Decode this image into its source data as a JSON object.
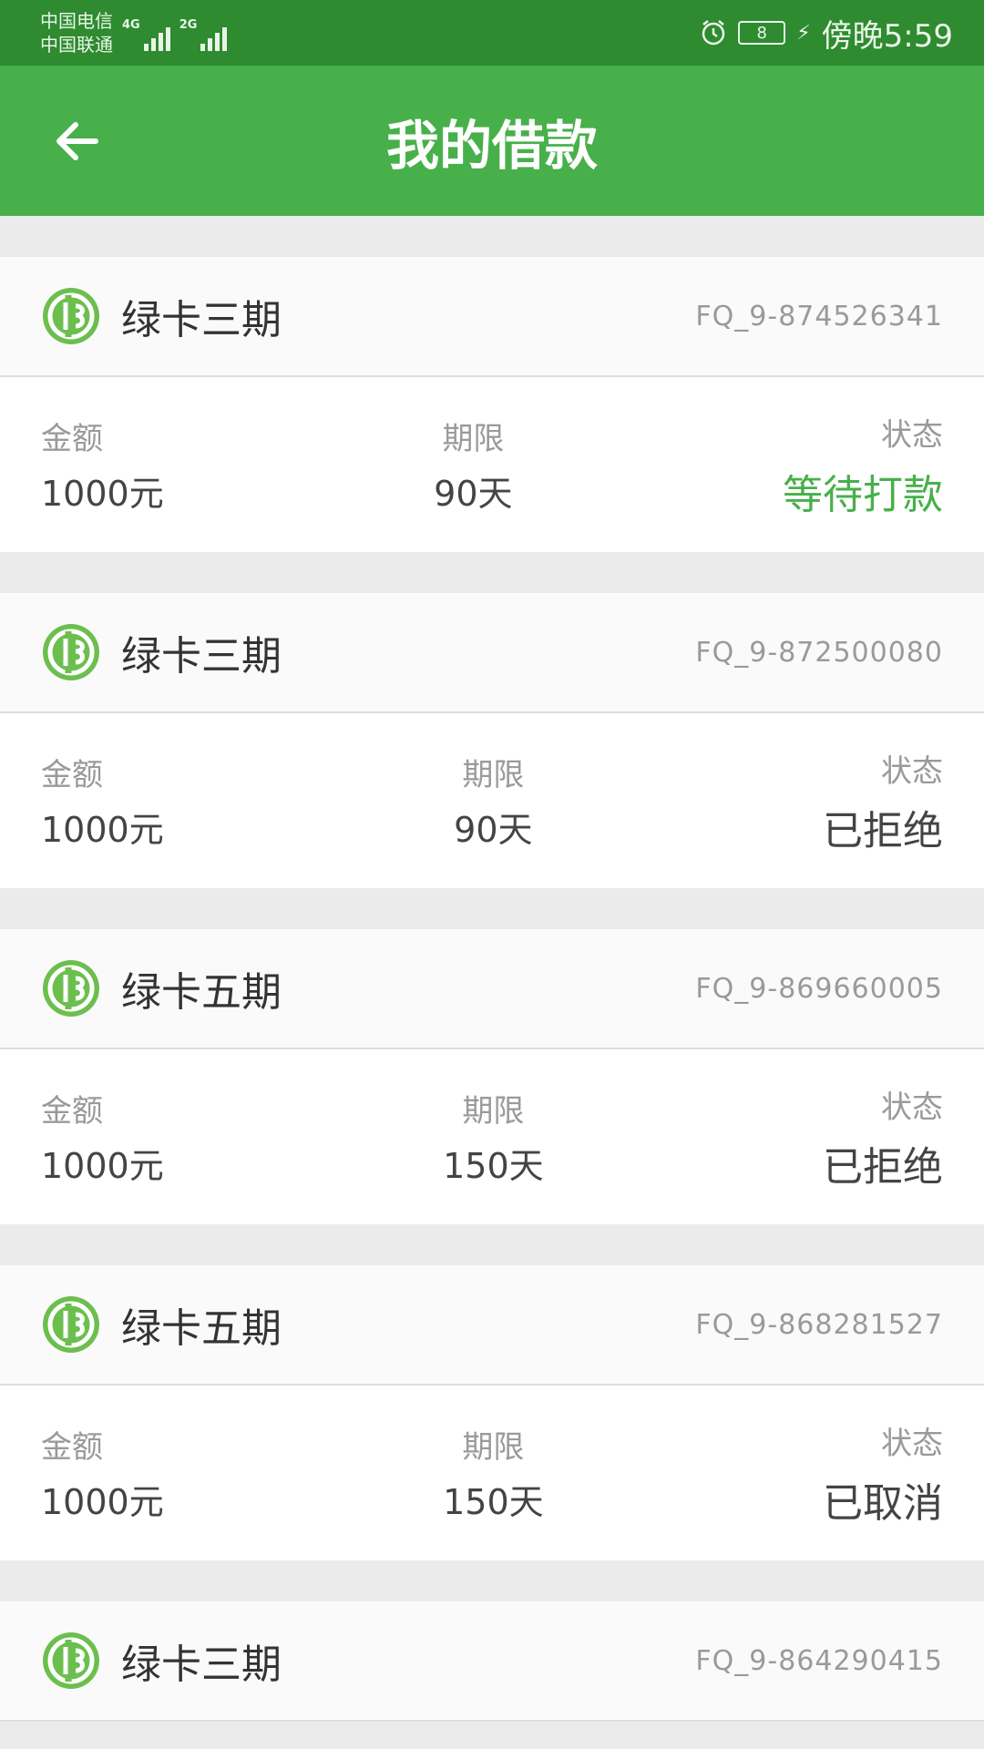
{
  "status_bar": {
    "carrier1": "中国电信",
    "carrier2": "中国联通",
    "net1": "4G",
    "net2": "2G",
    "battery": "8",
    "time": "傍晚5:59"
  },
  "header": {
    "title": "我的借款"
  },
  "colors": {
    "brand_green": "#47b04a",
    "status_bar": "#2e8b2f",
    "pending": "#47b04a"
  },
  "labels": {
    "amount": "金额",
    "term": "期限",
    "status": "状态"
  },
  "loans": [
    {
      "product": "绿卡三期",
      "order_no": "FQ_9-874526341",
      "amount": "1000元",
      "term": "90天",
      "status": "等待打款",
      "status_type": "pending"
    },
    {
      "product": "绿卡三期",
      "order_no": "FQ_9-872500080",
      "amount": "1000元",
      "term": "90天",
      "status": "已拒绝",
      "status_type": "rejected"
    },
    {
      "product": "绿卡五期",
      "order_no": "FQ_9-869660005",
      "amount": "1000元",
      "term": "150天",
      "status": "已拒绝",
      "status_type": "rejected"
    },
    {
      "product": "绿卡五期",
      "order_no": "FQ_9-868281527",
      "amount": "1000元",
      "term": "150天",
      "status": "已取消",
      "status_type": "cancelled"
    },
    {
      "product": "绿卡三期",
      "order_no": "FQ_9-864290415"
    }
  ]
}
